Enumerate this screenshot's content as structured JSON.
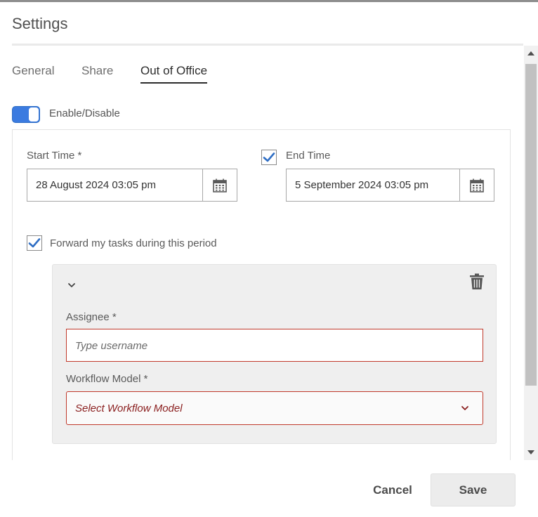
{
  "dialog": {
    "title": "Settings"
  },
  "tabs": [
    {
      "label": "General",
      "active": false
    },
    {
      "label": "Share",
      "active": false
    },
    {
      "label": "Out of Office",
      "active": true
    }
  ],
  "out_of_office": {
    "toggle": {
      "label": "Enable/Disable",
      "on": true
    },
    "start_time": {
      "label": "Start Time *",
      "value": "28 August 2024 03:05 pm"
    },
    "end_time": {
      "label": "End Time",
      "checked": true,
      "value": "5 September 2024 03:05 pm"
    },
    "forward": {
      "label": "Forward my tasks during this period",
      "checked": true,
      "assignee": {
        "label": "Assignee *",
        "placeholder": "Type username"
      },
      "workflow_model": {
        "label": "Workflow Model *",
        "placeholder": "Select Workflow Model"
      }
    }
  },
  "footer": {
    "cancel_label": "Cancel",
    "save_label": "Save"
  },
  "icons": {
    "calendar": "calendar-icon",
    "checkmark": "checkmark-icon",
    "trash": "trash-icon",
    "chevron": "chevron-down-icon"
  },
  "colors": {
    "accent": "#3b7be0",
    "error_border": "#c0392b",
    "check": "#2f6ec4"
  }
}
